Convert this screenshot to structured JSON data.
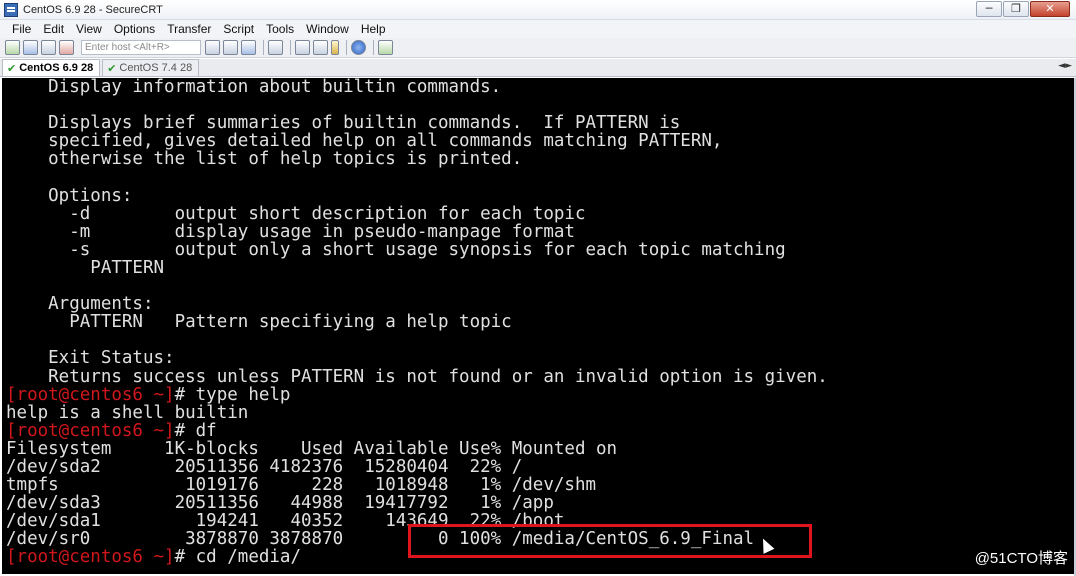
{
  "window": {
    "title": "CentOS 6.9 28 - SecureCRT",
    "minimize": "─",
    "restore": "❐",
    "close": "✕"
  },
  "menu": [
    "File",
    "Edit",
    "View",
    "Options",
    "Transfer",
    "Script",
    "Tools",
    "Window",
    "Help"
  ],
  "toolbar": {
    "quick_connect_placeholder": "Enter host <Alt+R>"
  },
  "tabs": [
    {
      "label": "CentOS 6.9 28",
      "active": true
    },
    {
      "label": "CentOS 7.4 28",
      "active": false
    }
  ],
  "tab_scroll": "◄►",
  "terminal": {
    "lines": [
      {
        "prompt": "",
        "text": "    Display information about builtin commands."
      },
      {
        "prompt": "",
        "text": ""
      },
      {
        "prompt": "",
        "text": "    Displays brief summaries of builtin commands.  If PATTERN is"
      },
      {
        "prompt": "",
        "text": "    specified, gives detailed help on all commands matching PATTERN,"
      },
      {
        "prompt": "",
        "text": "    otherwise the list of help topics is printed."
      },
      {
        "prompt": "",
        "text": ""
      },
      {
        "prompt": "",
        "text": "    Options:"
      },
      {
        "prompt": "",
        "text": "      -d        output short description for each topic"
      },
      {
        "prompt": "",
        "text": "      -m        display usage in pseudo-manpage format"
      },
      {
        "prompt": "",
        "text": "      -s        output only a short usage synopsis for each topic matching"
      },
      {
        "prompt": "",
        "text": "        PATTERN"
      },
      {
        "prompt": "",
        "text": ""
      },
      {
        "prompt": "",
        "text": "    Arguments:"
      },
      {
        "prompt": "",
        "text": "      PATTERN   Pattern specifiying a help topic"
      },
      {
        "prompt": "",
        "text": ""
      },
      {
        "prompt": "",
        "text": "    Exit Status:"
      },
      {
        "prompt": "",
        "text": "    Returns success unless PATTERN is not found or an invalid option is given."
      },
      {
        "prompt": "[root@centos6 ~]",
        "text": "# type help"
      },
      {
        "prompt": "",
        "text": "help is a shell builtin"
      },
      {
        "prompt": "[root@centos6 ~]",
        "text": "# df"
      },
      {
        "prompt": "",
        "text": "Filesystem     1K-blocks    Used Available Use% Mounted on"
      },
      {
        "prompt": "",
        "text": "/dev/sda2       20511356 4182376  15280404  22% /"
      },
      {
        "prompt": "",
        "text": "tmpfs            1019176     228   1018948   1% /dev/shm"
      },
      {
        "prompt": "",
        "text": "/dev/sda3       20511356   44988  19417792   1% /app"
      },
      {
        "prompt": "",
        "text": "/dev/sda1         194241   40352    143649  22% /boot"
      },
      {
        "prompt": "",
        "text": "/dev/sr0         3878870 3878870         0 100% /media/CentOS_6.9_Final"
      },
      {
        "prompt": "[root@centos6 ~]",
        "text": "# cd /media/"
      }
    ]
  },
  "watermark": "@51CTO博客",
  "colors": {
    "terminal_bg": "#000000",
    "terminal_fg": "#e0e0e0",
    "prompt": "#d0171b",
    "highlight_box": "#e0141c"
  }
}
